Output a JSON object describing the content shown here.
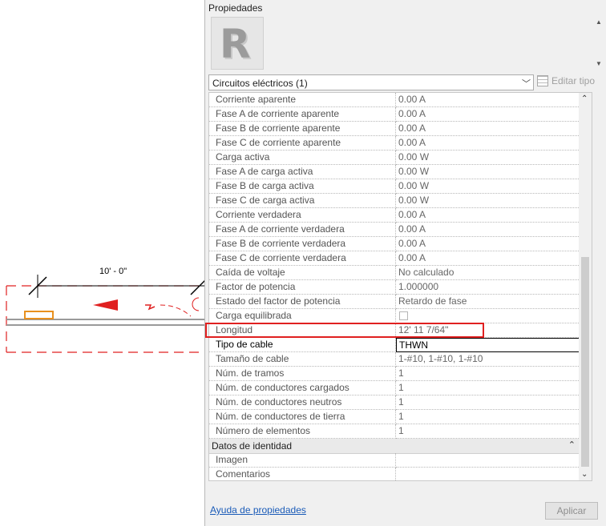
{
  "canvas": {
    "dimension_label": "10' - 0\""
  },
  "panel": {
    "title": "Propiedades",
    "logo_letter": "R",
    "type_selector": "Circuitos eléctricos (1)",
    "edit_type_label": "Editar tipo",
    "properties": [
      {
        "name": "Corriente aparente",
        "value": "0.00 A"
      },
      {
        "name": "Fase A de corriente aparente",
        "value": "0.00 A"
      },
      {
        "name": "Fase B de corriente aparente",
        "value": "0.00 A"
      },
      {
        "name": "Fase C de corriente aparente",
        "value": "0.00 A"
      },
      {
        "name": "Carga activa",
        "value": "0.00 W"
      },
      {
        "name": "Fase A de carga activa",
        "value": "0.00 W"
      },
      {
        "name": "Fase B de carga activa",
        "value": "0.00 W"
      },
      {
        "name": "Fase C de carga activa",
        "value": "0.00 W"
      },
      {
        "name": "Corriente verdadera",
        "value": "0.00 A"
      },
      {
        "name": "Fase A de corriente verdadera",
        "value": "0.00 A"
      },
      {
        "name": "Fase B de corriente verdadera",
        "value": "0.00 A"
      },
      {
        "name": "Fase C de corriente verdadera",
        "value": "0.00 A"
      },
      {
        "name": "Caída de voltaje",
        "value": "No calculado"
      },
      {
        "name": "Factor de potencia",
        "value": "1.000000"
      },
      {
        "name": "Estado del factor de potencia",
        "value": "Retardo de fase"
      },
      {
        "name": "Carga equilibrada",
        "value": ""
      },
      {
        "name": "Longitud",
        "value": "12'  11 7/64\""
      },
      {
        "name": "Tipo de cable",
        "value": "THWN"
      },
      {
        "name": "Tamaño de cable",
        "value": "1-#10, 1-#10, 1-#10"
      },
      {
        "name": "Núm. de tramos",
        "value": "1"
      },
      {
        "name": "Núm. de conductores cargados",
        "value": "1"
      },
      {
        "name": "Núm. de conductores neutros",
        "value": "1"
      },
      {
        "name": "Núm. de conductores de tierra",
        "value": "1"
      },
      {
        "name": "Número de elementos",
        "value": "1"
      }
    ],
    "group_identity": "Datos de identidad",
    "identity_properties": [
      {
        "name": "Imagen",
        "value": ""
      },
      {
        "name": "Comentarios",
        "value": ""
      }
    ],
    "help_link": "Ayuda de propiedades",
    "apply_button": "Aplicar"
  },
  "colors": {
    "highlight": "#e02020",
    "annotation_red": "#e02020",
    "tag_orange": "#e8901e",
    "link_blue": "#1a5bb8"
  }
}
